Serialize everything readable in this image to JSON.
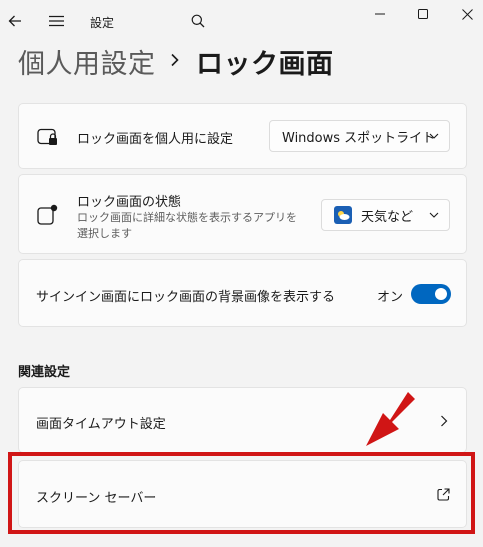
{
  "titlebar": {
    "back_icon": "back-arrow-icon",
    "menu_icon": "hamburger-menu-icon",
    "app_title": "設定",
    "search_icon": "search-icon",
    "minimize_icon": "minimize-icon",
    "maximize_icon": "maximize-icon",
    "close_icon": "close-icon"
  },
  "breadcrumb": {
    "parent": "個人用設定",
    "separator_icon": "chevron-right-icon",
    "current": "ロック画面"
  },
  "settings": [
    {
      "icon": "lock-screen-personalize-icon",
      "title": "ロック画面を個人用に設定",
      "control": "dropdown",
      "value": "Windows スポットライト"
    },
    {
      "icon": "lock-screen-status-icon",
      "title": "ロック画面の状態",
      "description": "ロック画面に詳細な状態を表示するアプリを選択します",
      "control": "dropdown",
      "value": "天気など",
      "value_icon": "weather-app-icon"
    },
    {
      "title": "サインイン画面にロック画面の背景画像を表示する",
      "control": "toggle",
      "state_label": "オン",
      "state": true
    }
  ],
  "related": {
    "heading": "関連設定",
    "items": [
      {
        "label": "画面タイムアウト設定",
        "trailing_icon": "chevron-right-icon"
      },
      {
        "label": "スクリーン セーバー",
        "trailing_icon": "external-link-icon"
      }
    ]
  },
  "annotations": {
    "arrow_icon": "red-down-arrow-icon",
    "highlight_color": "#d01515"
  },
  "colors": {
    "accent": "#0067c0",
    "background": "#f3f3f3",
    "card": "#fbfbfb"
  }
}
